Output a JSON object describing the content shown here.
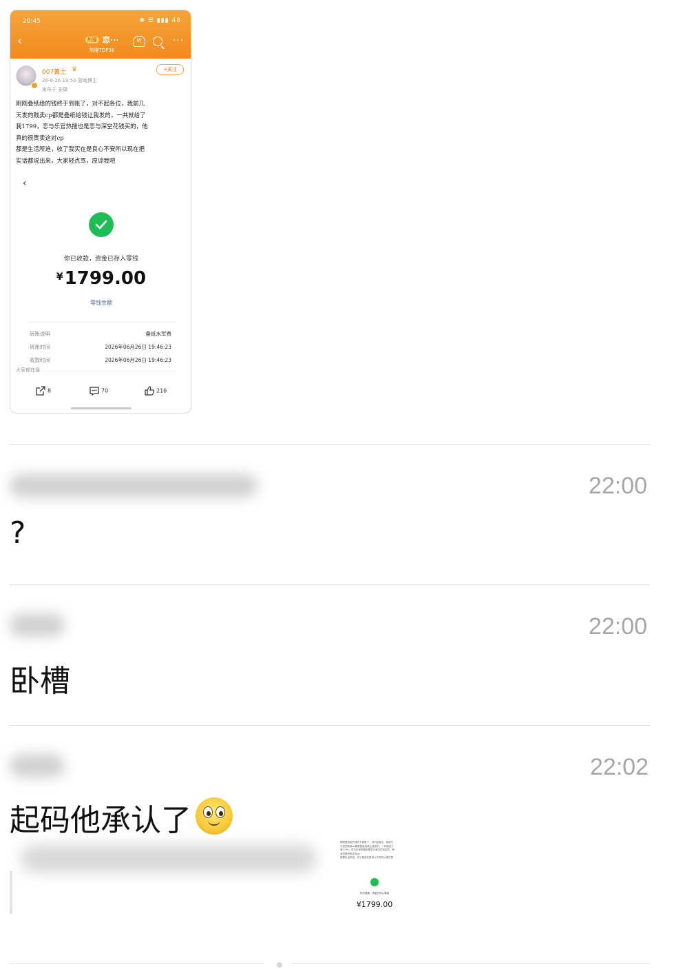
{
  "screenshot": {
    "status_time": "20:45",
    "status_icons": "✱ ☰ ▮▮▮ 48",
    "nav": {
      "hot_badge": "热搜",
      "title": "恋···",
      "subtitle": "热搜TOP36",
      "listen": "听"
    },
    "user": {
      "name": "007篝土",
      "crown": "♛",
      "meta": "26-6-26 19:50  游戏博主",
      "meta2": "发布于 安徽",
      "follow_label": "+关注"
    },
    "post_lines": [
      "刚刚叠纸给的钱终于到账了，对不起各位，我前几",
      "天发的贱卖cp都是叠纸给钱让我发的，一共就给了",
      "我1799，恋与乐官热搜也是恋与深空花钱买的，他",
      "真的很贵卖这对cp",
      "都是生活所迫，收了我实在是良心不安所以现在把",
      "实话都说出来，大家轻点骂，原谅我吧"
    ],
    "receipt": {
      "received_text": "你已收款，资金已存入零钱",
      "currency": "¥",
      "amount": "1799.00",
      "balance_link": "零钱余额",
      "rows": [
        {
          "key": "转账说明",
          "value": "叠纸水军费"
        },
        {
          "key": "转账时间",
          "value": "2026年06月26日 19:46:23"
        },
        {
          "key": "收款时间",
          "value": "2026年06月26日 19:46:23"
        }
      ]
    },
    "watching": "大家都在搜",
    "actions": {
      "share_count": "8",
      "comment_count": "70",
      "like_count": "216"
    }
  },
  "comments": [
    {
      "time": "22:00",
      "text": "?"
    },
    {
      "time": "22:00",
      "text": "卧槽"
    },
    {
      "time": "22:02",
      "text": "起码他承认了"
    }
  ],
  "thumbnail": {
    "recv_text": "你已收款，资金已存入零钱",
    "amount": "¥1799.00"
  },
  "colors": {
    "header_orange": "#f38a1d",
    "wechat_green": "#1fbb55",
    "timestamp_gray": "#a6a6a6"
  },
  "icons": [
    "back-arrow-icon",
    "headphone-icon",
    "search-icon",
    "more-icon",
    "check-icon",
    "share-icon",
    "comment-icon",
    "like-icon",
    "smile-emoji-icon"
  ]
}
